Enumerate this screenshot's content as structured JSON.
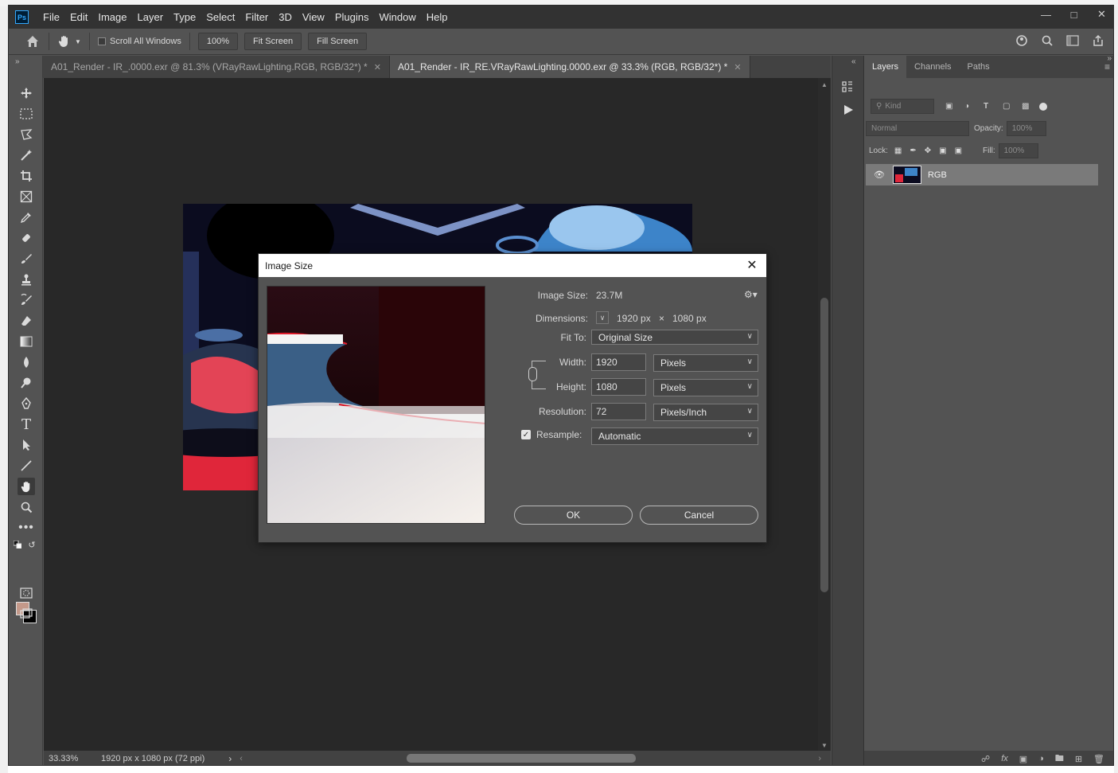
{
  "menubar": {
    "logo": "Ps",
    "items": [
      "File",
      "Edit",
      "Image",
      "Layer",
      "Type",
      "Select",
      "Filter",
      "3D",
      "View",
      "Plugins",
      "Window",
      "Help"
    ]
  },
  "options": {
    "scroll_all_windows": "Scroll All Windows",
    "zoom_100": "100%",
    "fit_screen": "Fit Screen",
    "fill_screen": "Fill Screen"
  },
  "tabs": [
    {
      "label": "A01_Render - IR_.0000.exr @ 81.3% (VRayRawLighting.RGB, RGB/32*) *",
      "active": false
    },
    {
      "label": "A01_Render - IR_RE.VRayRawLighting.0000.exr @ 33.3% (RGB, RGB/32*) *",
      "active": true
    }
  ],
  "status": {
    "zoom": "33.33%",
    "doc_info": "1920 px x 1080 px (72 ppi)"
  },
  "layers_panel": {
    "tabs": [
      "Layers",
      "Channels",
      "Paths"
    ],
    "kind": "Kind",
    "blend_mode": "Normal",
    "opacity_label": "Opacity:",
    "opacity_value": "100%",
    "lock_label": "Lock:",
    "fill_label": "Fill:",
    "fill_value": "100%",
    "layer_name": "RGB"
  },
  "dialog": {
    "title": "Image Size",
    "image_size_label": "Image Size:",
    "image_size_value": "23.7M",
    "dimensions_label": "Dimensions:",
    "dim_width": "1920 px",
    "dim_x": "×",
    "dim_height": "1080 px",
    "fit_to_label": "Fit To:",
    "fit_to_value": "Original Size",
    "width_label": "Width:",
    "width_value": "1920",
    "width_unit": "Pixels",
    "height_label": "Height:",
    "height_value": "1080",
    "height_unit": "Pixels",
    "resolution_label": "Resolution:",
    "resolution_value": "72",
    "resolution_unit": "Pixels/Inch",
    "resample_label": "Resample:",
    "resample_value": "Automatic",
    "ok": "OK",
    "cancel": "Cancel"
  },
  "colors": {
    "foreground": "#c4998a",
    "background": "#000000"
  }
}
